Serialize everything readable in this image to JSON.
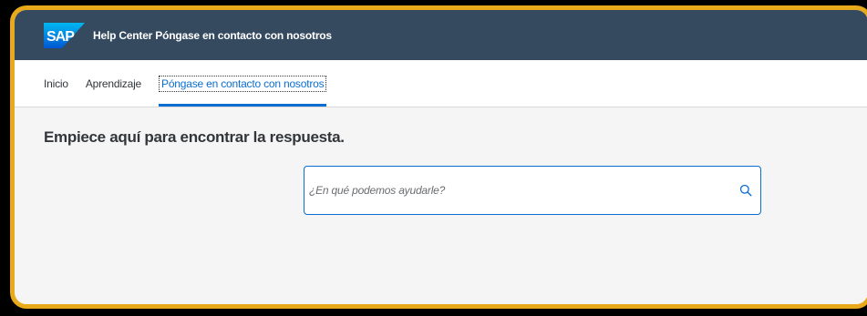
{
  "shell": {
    "logo_text": "SAP",
    "title": "Help Center Póngase en contacto con nosotros"
  },
  "tabs": [
    {
      "label": "Inicio",
      "selected": false
    },
    {
      "label": "Aprendizaje",
      "selected": false
    },
    {
      "label": "Póngase en contacto con nosotros",
      "selected": true
    }
  ],
  "main": {
    "heading": "Empiece aquí para encontrar la respuesta.",
    "search": {
      "placeholder": "¿En qué podemos ayudarle?",
      "value": ""
    }
  },
  "colors": {
    "shell_bg": "#354a5f",
    "accent": "#0a6ed1",
    "frame_border": "#e8a91a",
    "page_bg": "#f5f5f5"
  },
  "icons": {
    "search": "search-icon",
    "logo": "sap-logo-icon"
  }
}
